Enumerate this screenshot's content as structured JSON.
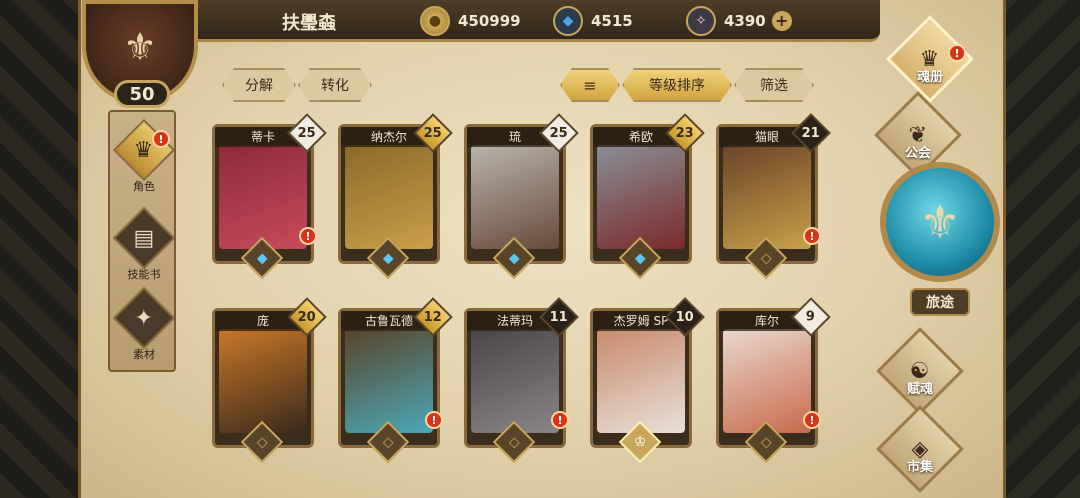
{
  "player": {
    "name": "扶璺螙",
    "level": "50"
  },
  "resources": {
    "coins": "450999",
    "crystals": "4515",
    "gems": "4390",
    "add_label": "+"
  },
  "sidebar": {
    "items": [
      {
        "label": "角色",
        "icon": "helmet-icon",
        "glyph": "♛",
        "alert": "!"
      },
      {
        "label": "技能书",
        "icon": "book-icon",
        "glyph": "▤",
        "alert": ""
      },
      {
        "label": "素材",
        "icon": "beast-icon",
        "glyph": "✦",
        "alert": ""
      }
    ]
  },
  "actions": {
    "decompose": "分解",
    "convert": "转化",
    "sort_icon": "≡",
    "sort_by_level": "等级排序",
    "filter": "筛选"
  },
  "cards": [
    {
      "name": "蒂卡",
      "level": "25",
      "level_style": "white",
      "foot": "blue",
      "foot_glyph": "◆",
      "alert": "!",
      "colors": [
        "#8c2a3a",
        "#c94a5a"
      ]
    },
    {
      "name": "纳杰尔",
      "level": "25",
      "level_style": "gold",
      "foot": "blue",
      "foot_glyph": "◆",
      "alert": "",
      "colors": [
        "#8a6a2a",
        "#c9a04a"
      ]
    },
    {
      "name": "琉",
      "level": "25",
      "level_style": "white",
      "foot": "blue",
      "foot_glyph": "◆",
      "alert": "",
      "colors": [
        "#b9b4ac",
        "#6a4a3a"
      ]
    },
    {
      "name": "希欧",
      "level": "23",
      "level_style": "gold",
      "foot": "blue",
      "foot_glyph": "◆",
      "alert": "",
      "colors": [
        "#8a8f96",
        "#7a2a2a"
      ]
    },
    {
      "name": "猫眼",
      "level": "21",
      "level_style": "dark",
      "foot": "plain",
      "foot_glyph": "◇",
      "alert": "!",
      "colors": [
        "#6a4428",
        "#c8a04a"
      ]
    },
    {
      "name": "庞",
      "level": "20",
      "level_style": "gold",
      "foot": "plain",
      "foot_glyph": "◇",
      "alert": "",
      "colors": [
        "#c8782a",
        "#3a2a1a"
      ]
    },
    {
      "name": "古鲁瓦德",
      "level": "12",
      "level_style": "gold",
      "foot": "plain",
      "foot_glyph": "◇",
      "alert": "!",
      "colors": [
        "#5a4428",
        "#4aa8b8"
      ]
    },
    {
      "name": "法蒂玛",
      "level": "11",
      "level_style": "dark",
      "foot": "plain",
      "foot_glyph": "◇",
      "alert": "!",
      "colors": [
        "#4a4648",
        "#8a8488"
      ]
    },
    {
      "name": "杰罗姆 SP",
      "level": "10",
      "level_style": "dark",
      "foot": "crown",
      "foot_glyph": "♔",
      "alert": "",
      "colors": [
        "#c88a6a",
        "#e8e0d8"
      ]
    },
    {
      "name": "库尔",
      "level": "9",
      "level_style": "white",
      "foot": "plain",
      "foot_glyph": "◇",
      "alert": "!",
      "colors": [
        "#e8d8cc",
        "#c86a4a"
      ]
    }
  ],
  "right_nav": {
    "soul_book": "魂册",
    "guild": "公会",
    "journey": "旅途",
    "soul_gift": "赋魂",
    "market": "市集",
    "soul_book_alert": "!"
  }
}
